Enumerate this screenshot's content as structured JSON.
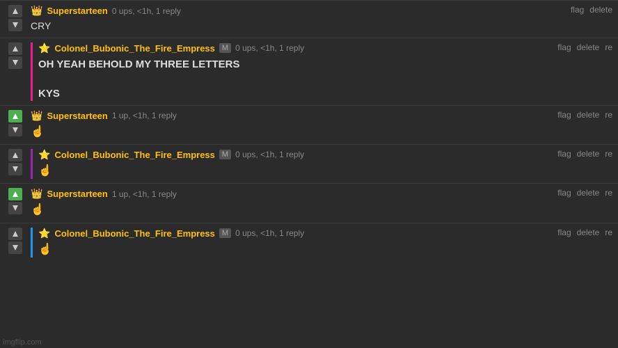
{
  "comments": [
    {
      "id": "c1",
      "user": "Superstarteen",
      "userIcon": "crown",
      "gender": null,
      "meta": "0 ups, <1h, 1 reply",
      "text": "CRY",
      "indent": null,
      "upvoted": false,
      "actions": [
        "flag",
        "delete"
      ]
    },
    {
      "id": "c2",
      "user": "Colonel_Bubonic_The_Fire_Empress",
      "userIcon": "star",
      "gender": "M",
      "meta": "0 ups, <1h, 1 reply",
      "text": "OH YEAH BEHOLD MY THREE LETTERS\n\nKYS",
      "indent": "pink",
      "upvoted": false,
      "actions": [
        "flag",
        "delete",
        "re"
      ]
    },
    {
      "id": "c3",
      "user": "Superstarteen",
      "userIcon": "crown",
      "gender": null,
      "meta": "1 up, <1h, 1 reply",
      "text": "👆",
      "indent": null,
      "upvoted": true,
      "actions": [
        "flag",
        "delete",
        "re"
      ]
    },
    {
      "id": "c4",
      "user": "Colonel_Bubonic_The_Fire_Empress",
      "userIcon": "star",
      "gender": "M",
      "meta": "0 ups, <1h, 1 reply",
      "text": "👆",
      "indent": "purple",
      "upvoted": false,
      "actions": [
        "flag",
        "delete",
        "re"
      ]
    },
    {
      "id": "c5",
      "user": "Superstarteen",
      "userIcon": "crown",
      "gender": null,
      "meta": "1 up, <1h, 1 reply",
      "text": "👆",
      "indent": null,
      "upvoted": true,
      "actions": [
        "flag",
        "delete",
        "re"
      ]
    },
    {
      "id": "c6",
      "user": "Colonel_Bubonic_The_Fire_Empress",
      "userIcon": "star",
      "gender": "M",
      "meta": "0 ups, <1h, 1 reply",
      "text": "👆",
      "indent": "blue",
      "upvoted": false,
      "actions": [
        "flag",
        "delete",
        "re"
      ]
    }
  ],
  "footer": "imgflip.com"
}
